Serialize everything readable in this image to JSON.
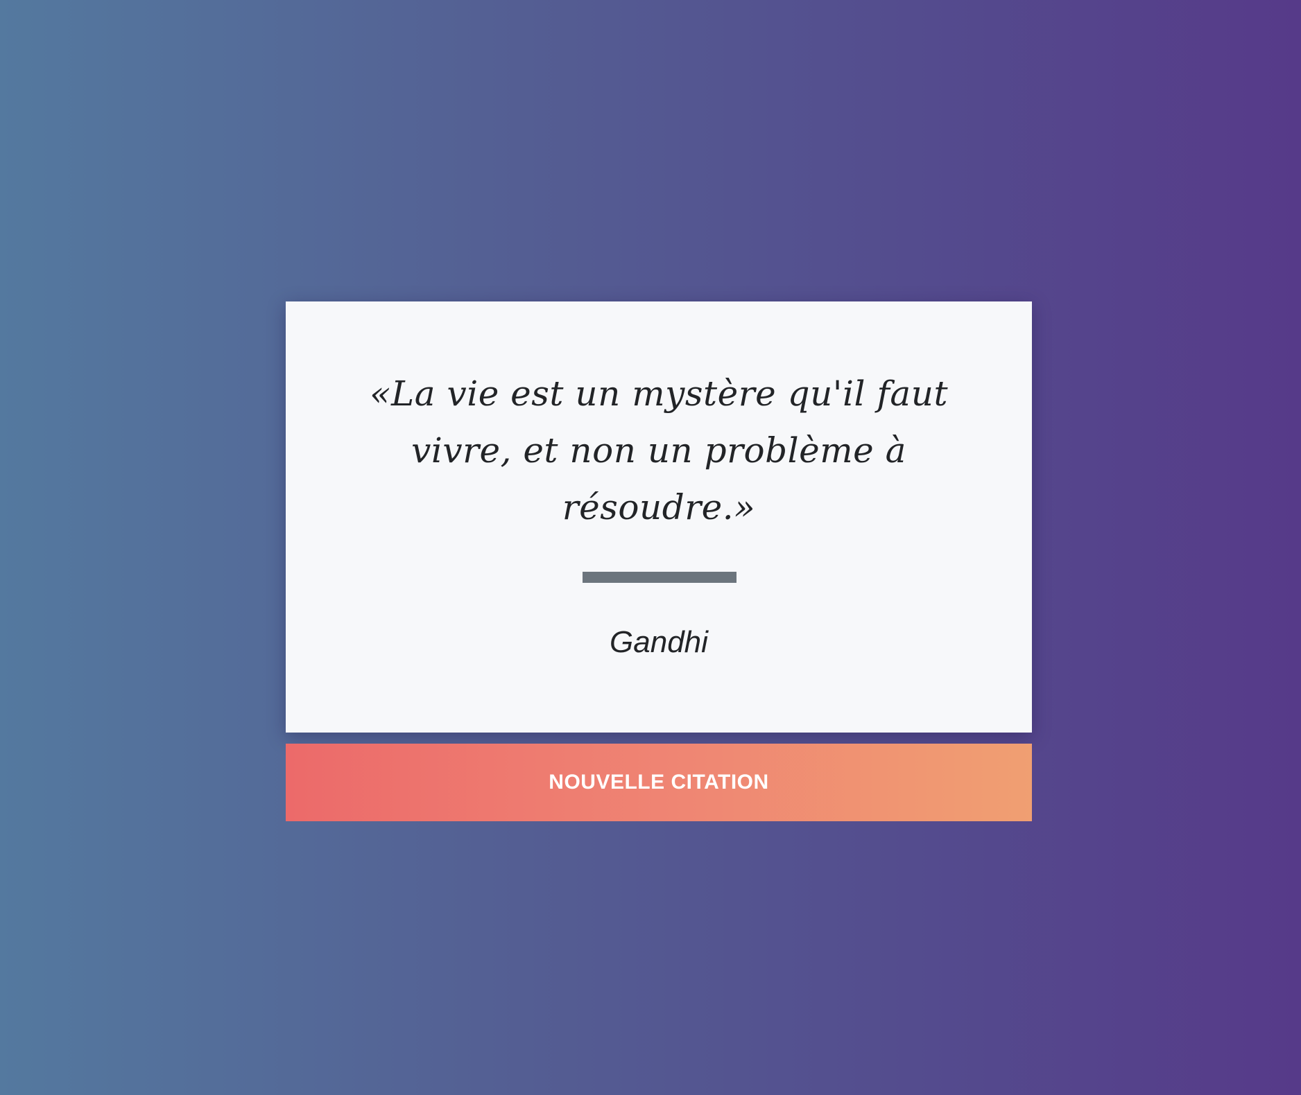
{
  "theme": {
    "background_gradient": [
      "#54799f",
      "#563a89"
    ],
    "card_background": "#f7f8fa",
    "text_color": "#222427",
    "divider_color": "#6c757d",
    "button_gradient": [
      "#ec6a6a",
      "#f09f72"
    ],
    "button_text_color": "#ffffff"
  },
  "quote": {
    "text": "«La vie est un mystère qu'il faut vivre, et non un problème à résoudre.»",
    "author": "Gandhi"
  },
  "actions": {
    "new_quote_label": "NOUVELLE CITATION"
  }
}
